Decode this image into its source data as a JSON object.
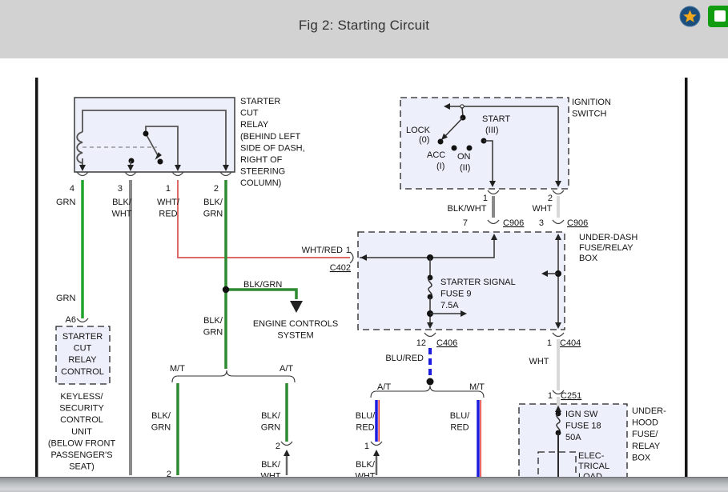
{
  "header": {
    "title": "Fig 2: Starting Circuit"
  },
  "colors": {
    "titlebar": "#d2d2d2",
    "box_fill": "#edeffa",
    "grn": "#1fa32b",
    "blk_grn": "#2e8b31",
    "blk_wht": "#8a8a8a",
    "wht": "#d9d9d9",
    "wht_red": "#dd6a66",
    "blu": "#1c1cdf",
    "red_stripe": "#e23131",
    "star_gold": "#f2a81d",
    "star_bg": "#1a4e7e",
    "btn_green": "#129c12"
  },
  "labels": {
    "relay_note": "STARTER\nCUT\nRELAY\n(BEHIND LEFT\nSIDE OF DASH,\nRIGHT OF\nSTEERING\nCOLUMN)",
    "ignition": "IGNITION\nSWITCH",
    "lock": "LOCK",
    "lock_pos": "(0)",
    "acc": "ACC",
    "acc_pos": "(I)",
    "on": "ON",
    "on_pos": "(II)",
    "start": "START",
    "start_pos": "(III)",
    "under_dash": "UNDER-DASH\nFUSE/RELAY\nBOX",
    "under_hood": "UNDER-\nHOOD\nFUSE/\nRELAY\nBOX",
    "fuse9": "STARTER SIGNAL\nFUSE 9\n7.5A",
    "fuse18": "IGN SW\nFUSE 18\n50A",
    "elec_load": "ELEC-\nTRICAL\nLOAD",
    "engine_controls": "ENGINE CONTROLS\nSYSTEM",
    "scr_control": "STARTER\nCUT\nRELAY\nCONTROL",
    "keyless": "KEYLESS/\nSECURITY\nCONTROL\nUNIT\n(BELOW FRONT\nPASSENGER'S\nSEAT)",
    "grn": "GRN",
    "wht": "WHT",
    "blk_wht": "BLK/\nWHT",
    "wht_red": "WHT/\nRED",
    "blk_grn": "BLK/\nGRN",
    "blu_red": "BLU/\nRED",
    "blk_wht_1": "BLK/WHT",
    "wht_red_1": "WHT/RED",
    "blu_red_1": "BLU/RED",
    "blk_grn_1": "BLK/GRN",
    "mt": "M/T",
    "at": "A/T",
    "n1": "1",
    "n2": "2",
    "n3": "3",
    "n4": "4",
    "n7": "7",
    "n12": "12",
    "a6": "A6",
    "c402": "C402",
    "c404": "C404",
    "c406": "C406",
    "c251": "C251",
    "c906": "C906"
  }
}
